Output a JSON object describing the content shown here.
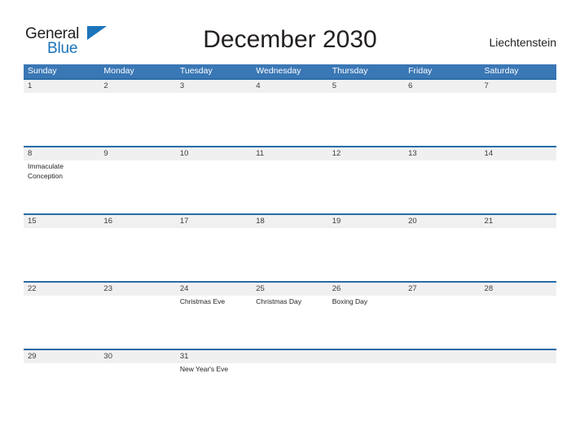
{
  "brand": {
    "name_part1": "General",
    "name_part2": "Blue",
    "flag_icon": "blue-triangle-flag-icon",
    "color_dark": "#231f20",
    "color_blue": "#1b75bb"
  },
  "header": {
    "title": "December 2030",
    "country": "Liechtenstein"
  },
  "theme": {
    "header_blue": "#3a77b5",
    "rule_blue": "#2a6ba8",
    "date_stripe_gray": "#f0f0f0",
    "text_color": "#231f20"
  },
  "calendar": {
    "month": "December",
    "year": "2030",
    "weekday_headers": [
      "Sunday",
      "Monday",
      "Tuesday",
      "Wednesday",
      "Thursday",
      "Friday",
      "Saturday"
    ],
    "weeks": [
      {
        "dates": [
          "1",
          "2",
          "3",
          "4",
          "5",
          "6",
          "7"
        ],
        "events": [
          "",
          "",
          "",
          "",
          "",
          "",
          ""
        ]
      },
      {
        "dates": [
          "8",
          "9",
          "10",
          "11",
          "12",
          "13",
          "14"
        ],
        "events": [
          "Immaculate Conception",
          "",
          "",
          "",
          "",
          "",
          ""
        ]
      },
      {
        "dates": [
          "15",
          "16",
          "17",
          "18",
          "19",
          "20",
          "21"
        ],
        "events": [
          "",
          "",
          "",
          "",
          "",
          "",
          ""
        ]
      },
      {
        "dates": [
          "22",
          "23",
          "24",
          "25",
          "26",
          "27",
          "28"
        ],
        "events": [
          "",
          "",
          "Christmas Eve",
          "Christmas Day",
          "Boxing Day",
          "",
          ""
        ]
      },
      {
        "dates": [
          "29",
          "30",
          "31",
          "",
          "",
          "",
          ""
        ],
        "events": [
          "",
          "",
          "New Year's Eve",
          "",
          "",
          "",
          ""
        ]
      }
    ]
  }
}
